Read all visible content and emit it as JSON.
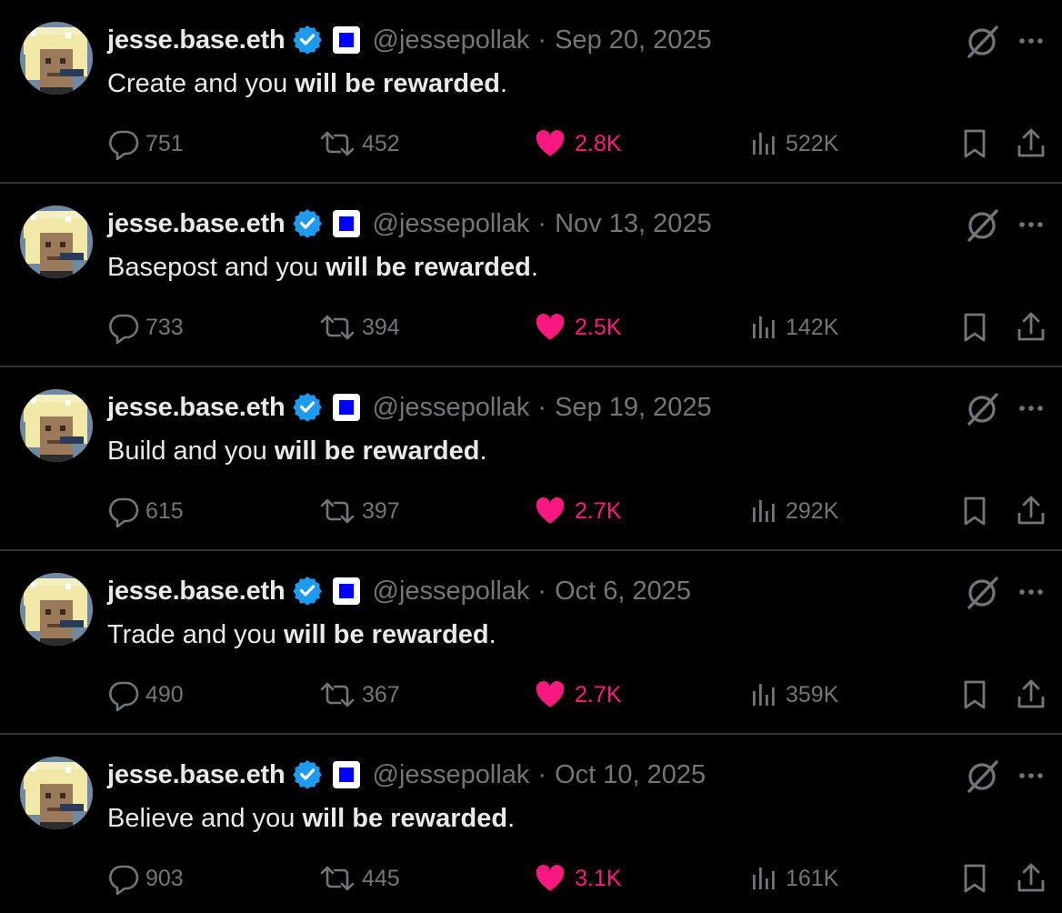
{
  "colors": {
    "background": "#000000",
    "primary_text": "#e7e9ea",
    "secondary_text": "#71767b",
    "like": "#f91880",
    "verified": "#1d9bf0",
    "divider": "#2f3336",
    "affiliate_badge": "#0000ff"
  },
  "icons": {
    "verified": "verified-badge-icon",
    "affiliate": "affiliate-badge-icon",
    "grok": "grok-icon",
    "more": "more-icon",
    "reply": "reply-icon",
    "retweet": "retweet-icon",
    "like": "heart-icon",
    "views": "views-icon",
    "bookmark": "bookmark-icon",
    "share": "share-icon"
  },
  "tweets": [
    {
      "author": {
        "name": "jesse.base.eth",
        "handle": "@jessepollak"
      },
      "date": "Sep 20, 2025",
      "text_plain": "Create and you ",
      "text_bold": "will be rewarded",
      "text_end": ".",
      "replies": "751",
      "retweets": "452",
      "likes": "2.8K",
      "views": "522K"
    },
    {
      "author": {
        "name": "jesse.base.eth",
        "handle": "@jessepollak"
      },
      "date": "Nov 13, 2025",
      "text_plain": "Basepost and you ",
      "text_bold": "will be rewarded",
      "text_end": ".",
      "replies": "733",
      "retweets": "394",
      "likes": "2.5K",
      "views": "142K"
    },
    {
      "author": {
        "name": "jesse.base.eth",
        "handle": "@jessepollak"
      },
      "date": "Sep 19, 2025",
      "text_plain": "Build and you ",
      "text_bold": "will be rewarded",
      "text_end": ".",
      "replies": "615",
      "retweets": "397",
      "likes": "2.7K",
      "views": "292K"
    },
    {
      "author": {
        "name": "jesse.base.eth",
        "handle": "@jessepollak"
      },
      "date": "Oct 6, 2025",
      "text_plain": "Trade and you ",
      "text_bold": "will be rewarded",
      "text_end": ".",
      "replies": "490",
      "retweets": "367",
      "likes": "2.7K",
      "views": "359K"
    },
    {
      "author": {
        "name": "jesse.base.eth",
        "handle": "@jessepollak"
      },
      "date": "Oct 10, 2025",
      "text_plain": "Believe and you ",
      "text_bold": "will be rewarded",
      "text_end": ".",
      "replies": "903",
      "retweets": "445",
      "likes": "3.1K",
      "views": "161K"
    }
  ]
}
